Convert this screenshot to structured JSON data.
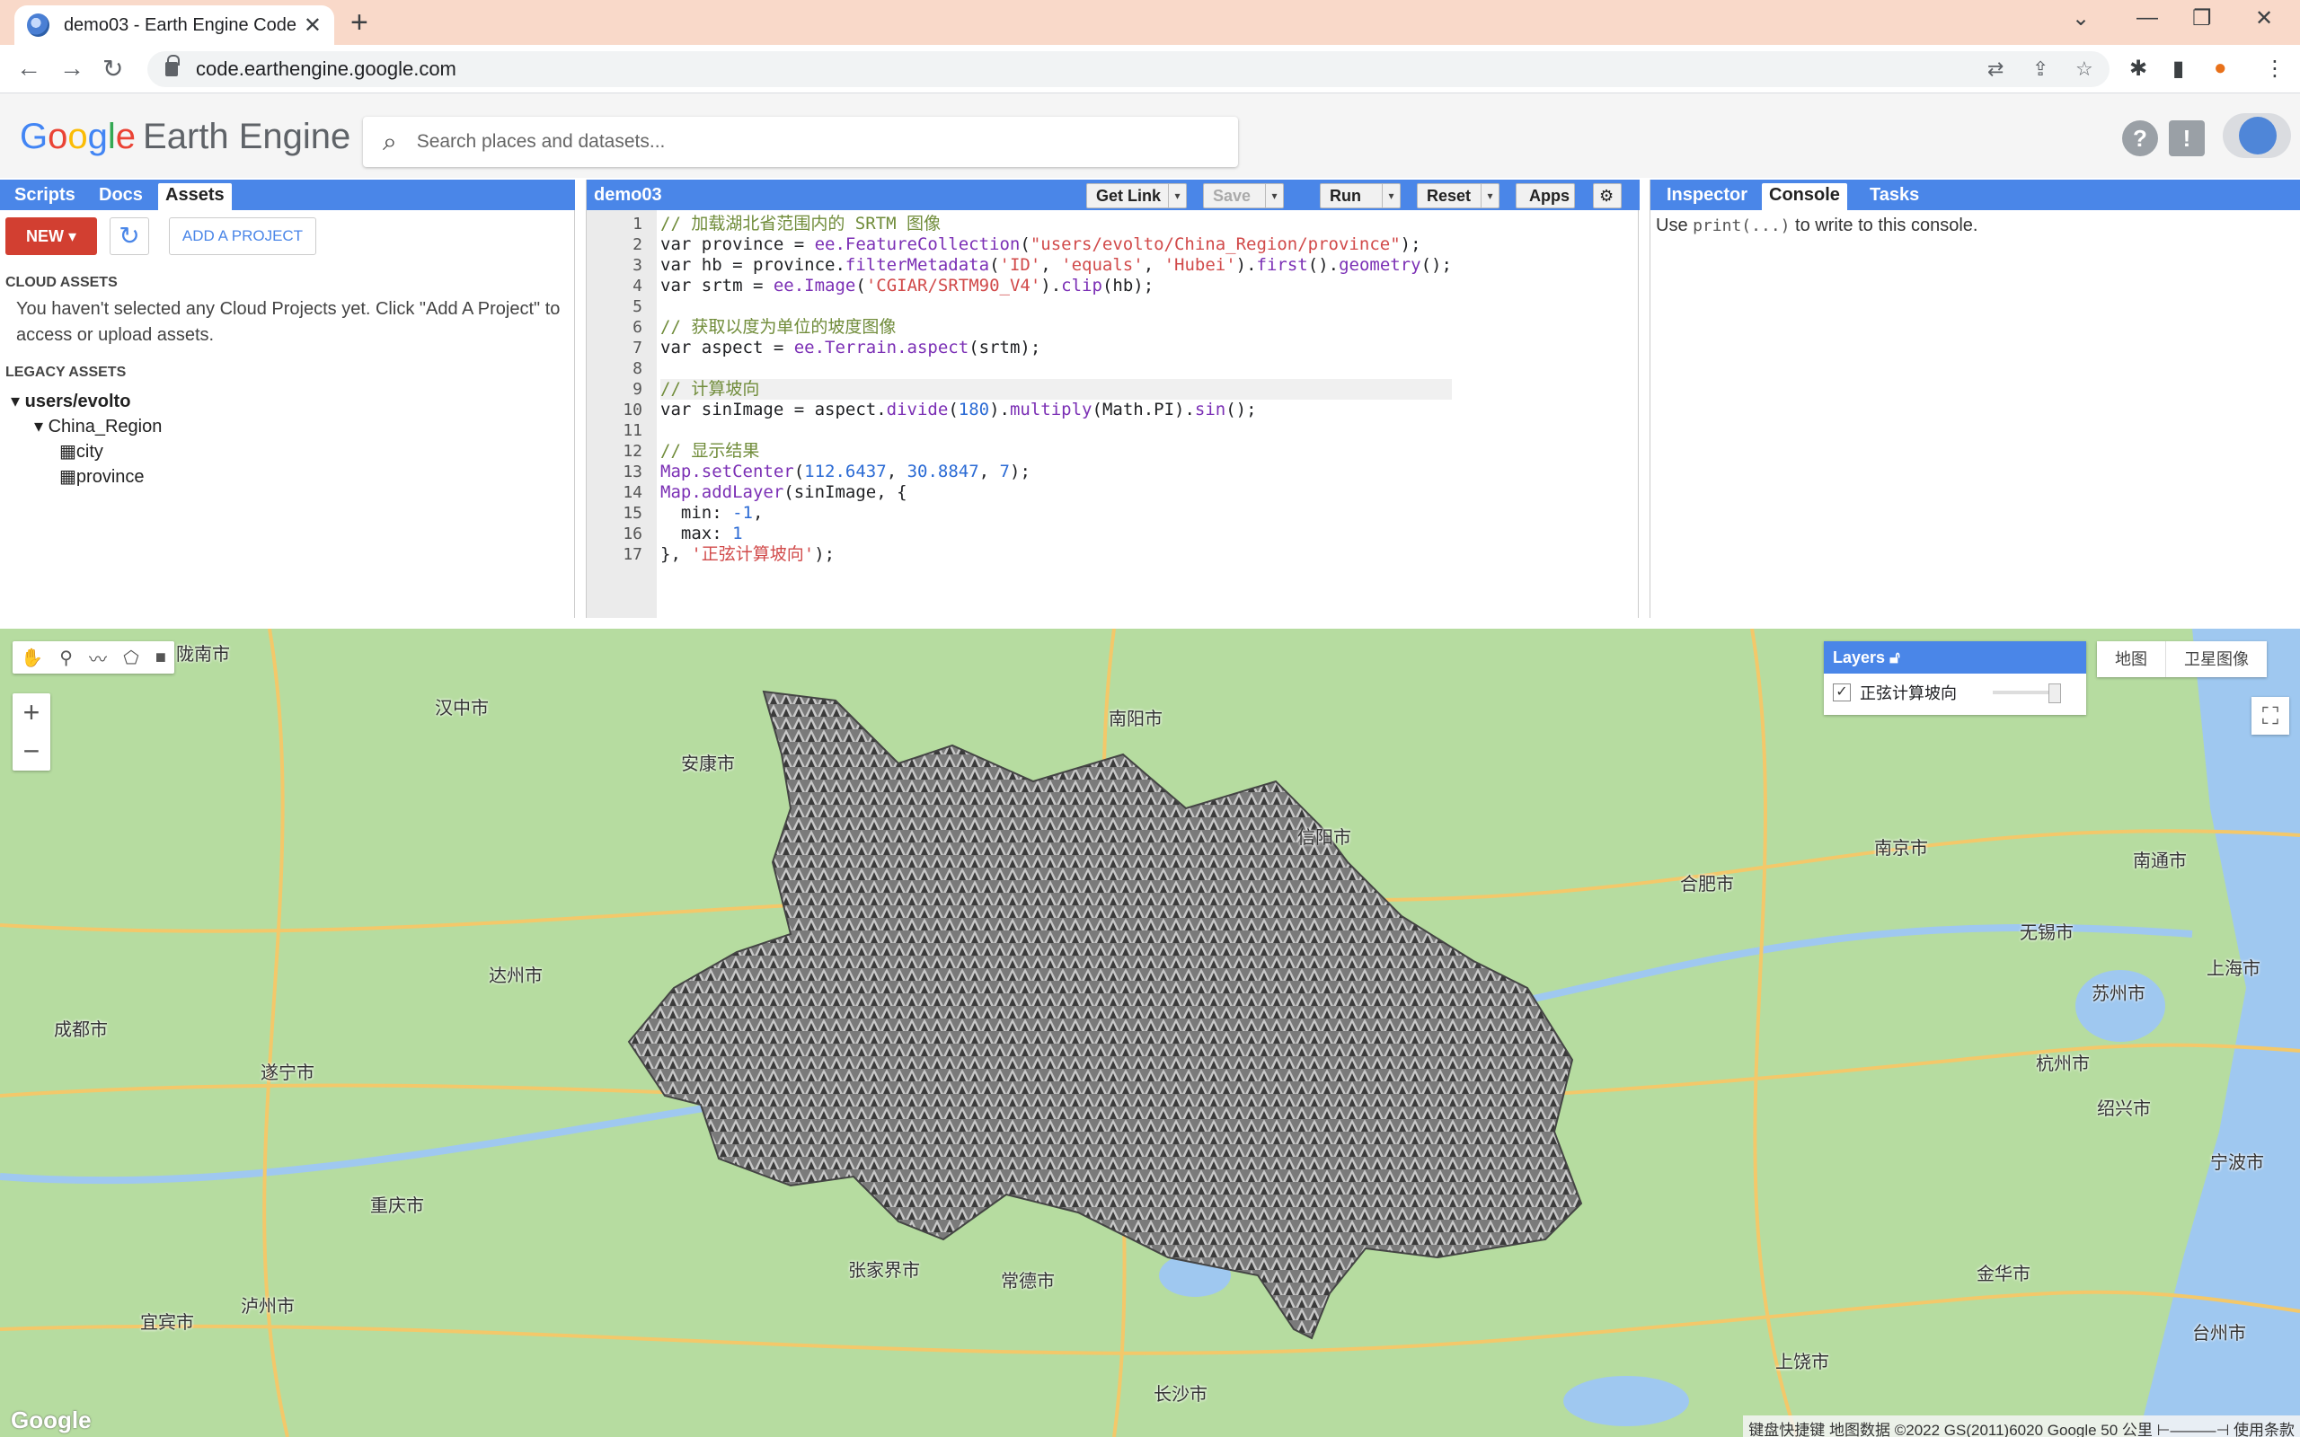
{
  "browser": {
    "tab_title": "demo03 - Earth Engine Code E",
    "url": "code.earthengine.google.com"
  },
  "header": {
    "logo_google": [
      "G",
      "o",
      "o",
      "g",
      "l",
      "e"
    ],
    "logo_product": "Earth Engine",
    "search_placeholder": "Search places and datasets..."
  },
  "left_panel": {
    "tabs": [
      "Scripts",
      "Docs",
      "Assets"
    ],
    "active_tab": "Assets",
    "new_label": "NEW",
    "add_project_label": "ADD A PROJECT",
    "cloud_assets_header": "CLOUD ASSETS",
    "cloud_assets_msg": "You haven't selected any Cloud Projects yet. Click \"Add A Project\" to access or upload assets.",
    "legacy_assets_header": "LEGACY ASSETS",
    "tree": {
      "root": "users/evolto",
      "folder": "China_Region",
      "items": [
        "city",
        "province"
      ]
    }
  },
  "editor": {
    "script_name": "demo03",
    "buttons": {
      "get_link": "Get Link",
      "save": "Save",
      "run": "Run",
      "reset": "Reset",
      "apps": "Apps"
    },
    "lines": [
      "// 加载湖北省范围内的 SRTM 图像",
      "var province = ee.FeatureCollection(\"users/evolto/China_Region/province\");",
      "var hb = province.filterMetadata('ID', 'equals', 'Hubei').first().geometry();",
      "var srtm = ee.Image('CGIAR/SRTM90_V4').clip(hb);",
      "",
      "// 获取以度为单位的坡度图像",
      "var aspect = ee.Terrain.aspect(srtm);",
      "",
      "// 计算坡向",
      "var sinImage = aspect.divide(180).multiply(Math.PI).sin();",
      "",
      "// 显示结果",
      "Map.setCenter(112.6437, 30.8847, 7);",
      "Map.addLayer(sinImage, {",
      "  min: -1,",
      "  max: 1",
      "}, '正弦计算坡向');"
    ]
  },
  "right_panel": {
    "tabs": [
      "Inspector",
      "Console",
      "Tasks"
    ],
    "active_tab": "Console",
    "console_msg_before": "Use ",
    "console_msg_code": "print(...)",
    "console_msg_after": " to write to this console."
  },
  "map": {
    "layers_title": "Layers",
    "layer_name": "正弦计算坡向",
    "map_types": [
      "地图",
      "卫星图像"
    ],
    "cities": [
      "陇南市",
      "汉中市",
      "安康市",
      "南阳市",
      "信阳市",
      "合肥市",
      "南京市",
      "南通市",
      "达州市",
      "无锡市",
      "苏州市",
      "上海市",
      "成都市",
      "遂宁市",
      "杭州市",
      "绍兴市",
      "宁波市",
      "重庆市",
      "张家界市",
      "常德市",
      "金华市",
      "泸州市",
      "宜宾市",
      "长沙市",
      "上饶市",
      "台州市"
    ],
    "google_mark": "Google",
    "attribution": "键盘快捷键   地图数据 ©2022 GS(2011)6020 Google   50 公里 ⊢———⊣   使用条款"
  }
}
